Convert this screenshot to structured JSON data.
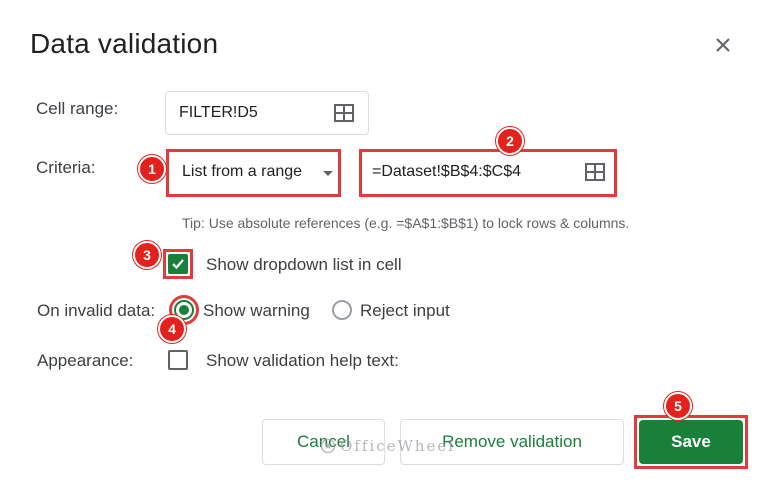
{
  "dialog": {
    "title": "Data validation",
    "close_icon": "close-icon"
  },
  "cell_range": {
    "label": "Cell range:",
    "value": "FILTER!D5",
    "icon": "grid-icon"
  },
  "criteria": {
    "label": "Criteria:",
    "type_value": "List from a range",
    "range_value": "=Dataset!$B$4:$C$4",
    "icon": "grid-icon",
    "tip": "Tip: Use absolute references (e.g. =$A$1:$B$1) to lock rows & columns."
  },
  "dropdown_option": {
    "label": "Show dropdown list in cell",
    "checked": true
  },
  "invalid_data": {
    "label": "On invalid data:",
    "options": [
      {
        "label": "Show warning",
        "selected": true
      },
      {
        "label": "Reject input",
        "selected": false
      }
    ]
  },
  "appearance": {
    "label": "Appearance:",
    "checkbox_label": "Show validation help text:",
    "checked": false
  },
  "buttons": {
    "cancel": "Cancel",
    "remove": "Remove validation",
    "save": "Save"
  },
  "annotations": {
    "badges": [
      "1",
      "2",
      "3",
      "4",
      "5"
    ],
    "frame_color": "#e03c3c",
    "badge_color": "#e3211d"
  },
  "watermark": {
    "text": "OfficeWheel"
  },
  "colors": {
    "accent_green": "#188038",
    "border_gray": "#dadce0",
    "text_dark": "#202124",
    "text_muted": "#5f6368"
  }
}
